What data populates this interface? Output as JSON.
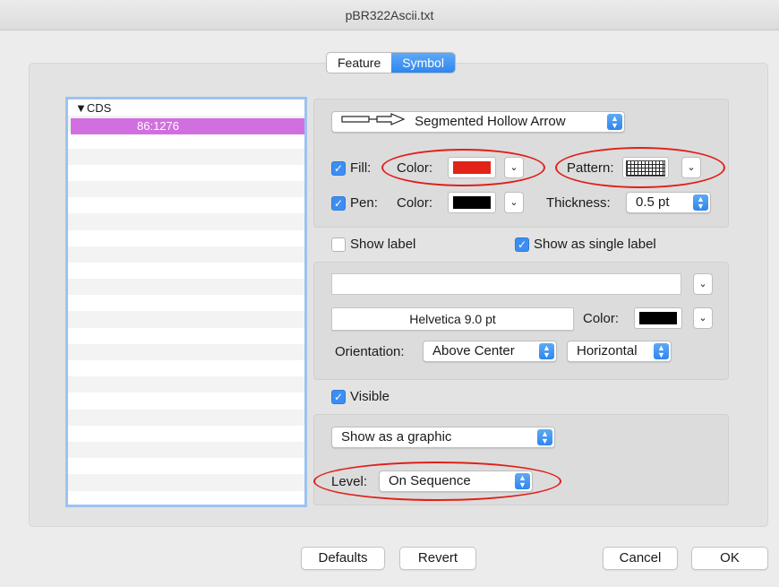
{
  "window": {
    "title": "pBR322Ascii.txt"
  },
  "tabs": [
    {
      "label": "Feature"
    },
    {
      "label": "Symbol"
    }
  ],
  "list": {
    "header": "▼CDS",
    "selected_item": "86:1276"
  },
  "shape": {
    "selected": "Segmented Hollow Arrow"
  },
  "fill": {
    "checkbox_label": "Fill:",
    "checked": true,
    "color_label": "Color:",
    "color": "#e2231a",
    "pattern_label": "Pattern:"
  },
  "pen": {
    "checkbox_label": "Pen:",
    "checked": true,
    "color_label": "Color:",
    "color": "#000000",
    "thickness_label": "Thickness:",
    "thickness": "0.5 pt"
  },
  "labels": {
    "show_label": "Show label",
    "show_label_checked": false,
    "single_label": "Show as single label",
    "single_label_checked": true
  },
  "label_settings": {
    "text_value": "",
    "font": "Helvetica 9.0 pt",
    "color_label": "Color:",
    "color": "#000000",
    "orientation_label": "Orientation:",
    "orientation": "Above Center",
    "direction": "Horizontal"
  },
  "visible": {
    "label": "Visible",
    "checked": true
  },
  "graphic": {
    "display": "Show as a graphic",
    "level_label": "Level:",
    "level": "On Sequence"
  },
  "footer": {
    "defaults": "Defaults",
    "revert": "Revert",
    "cancel": "Cancel",
    "ok": "OK"
  },
  "highlight_color": "#e0201a"
}
